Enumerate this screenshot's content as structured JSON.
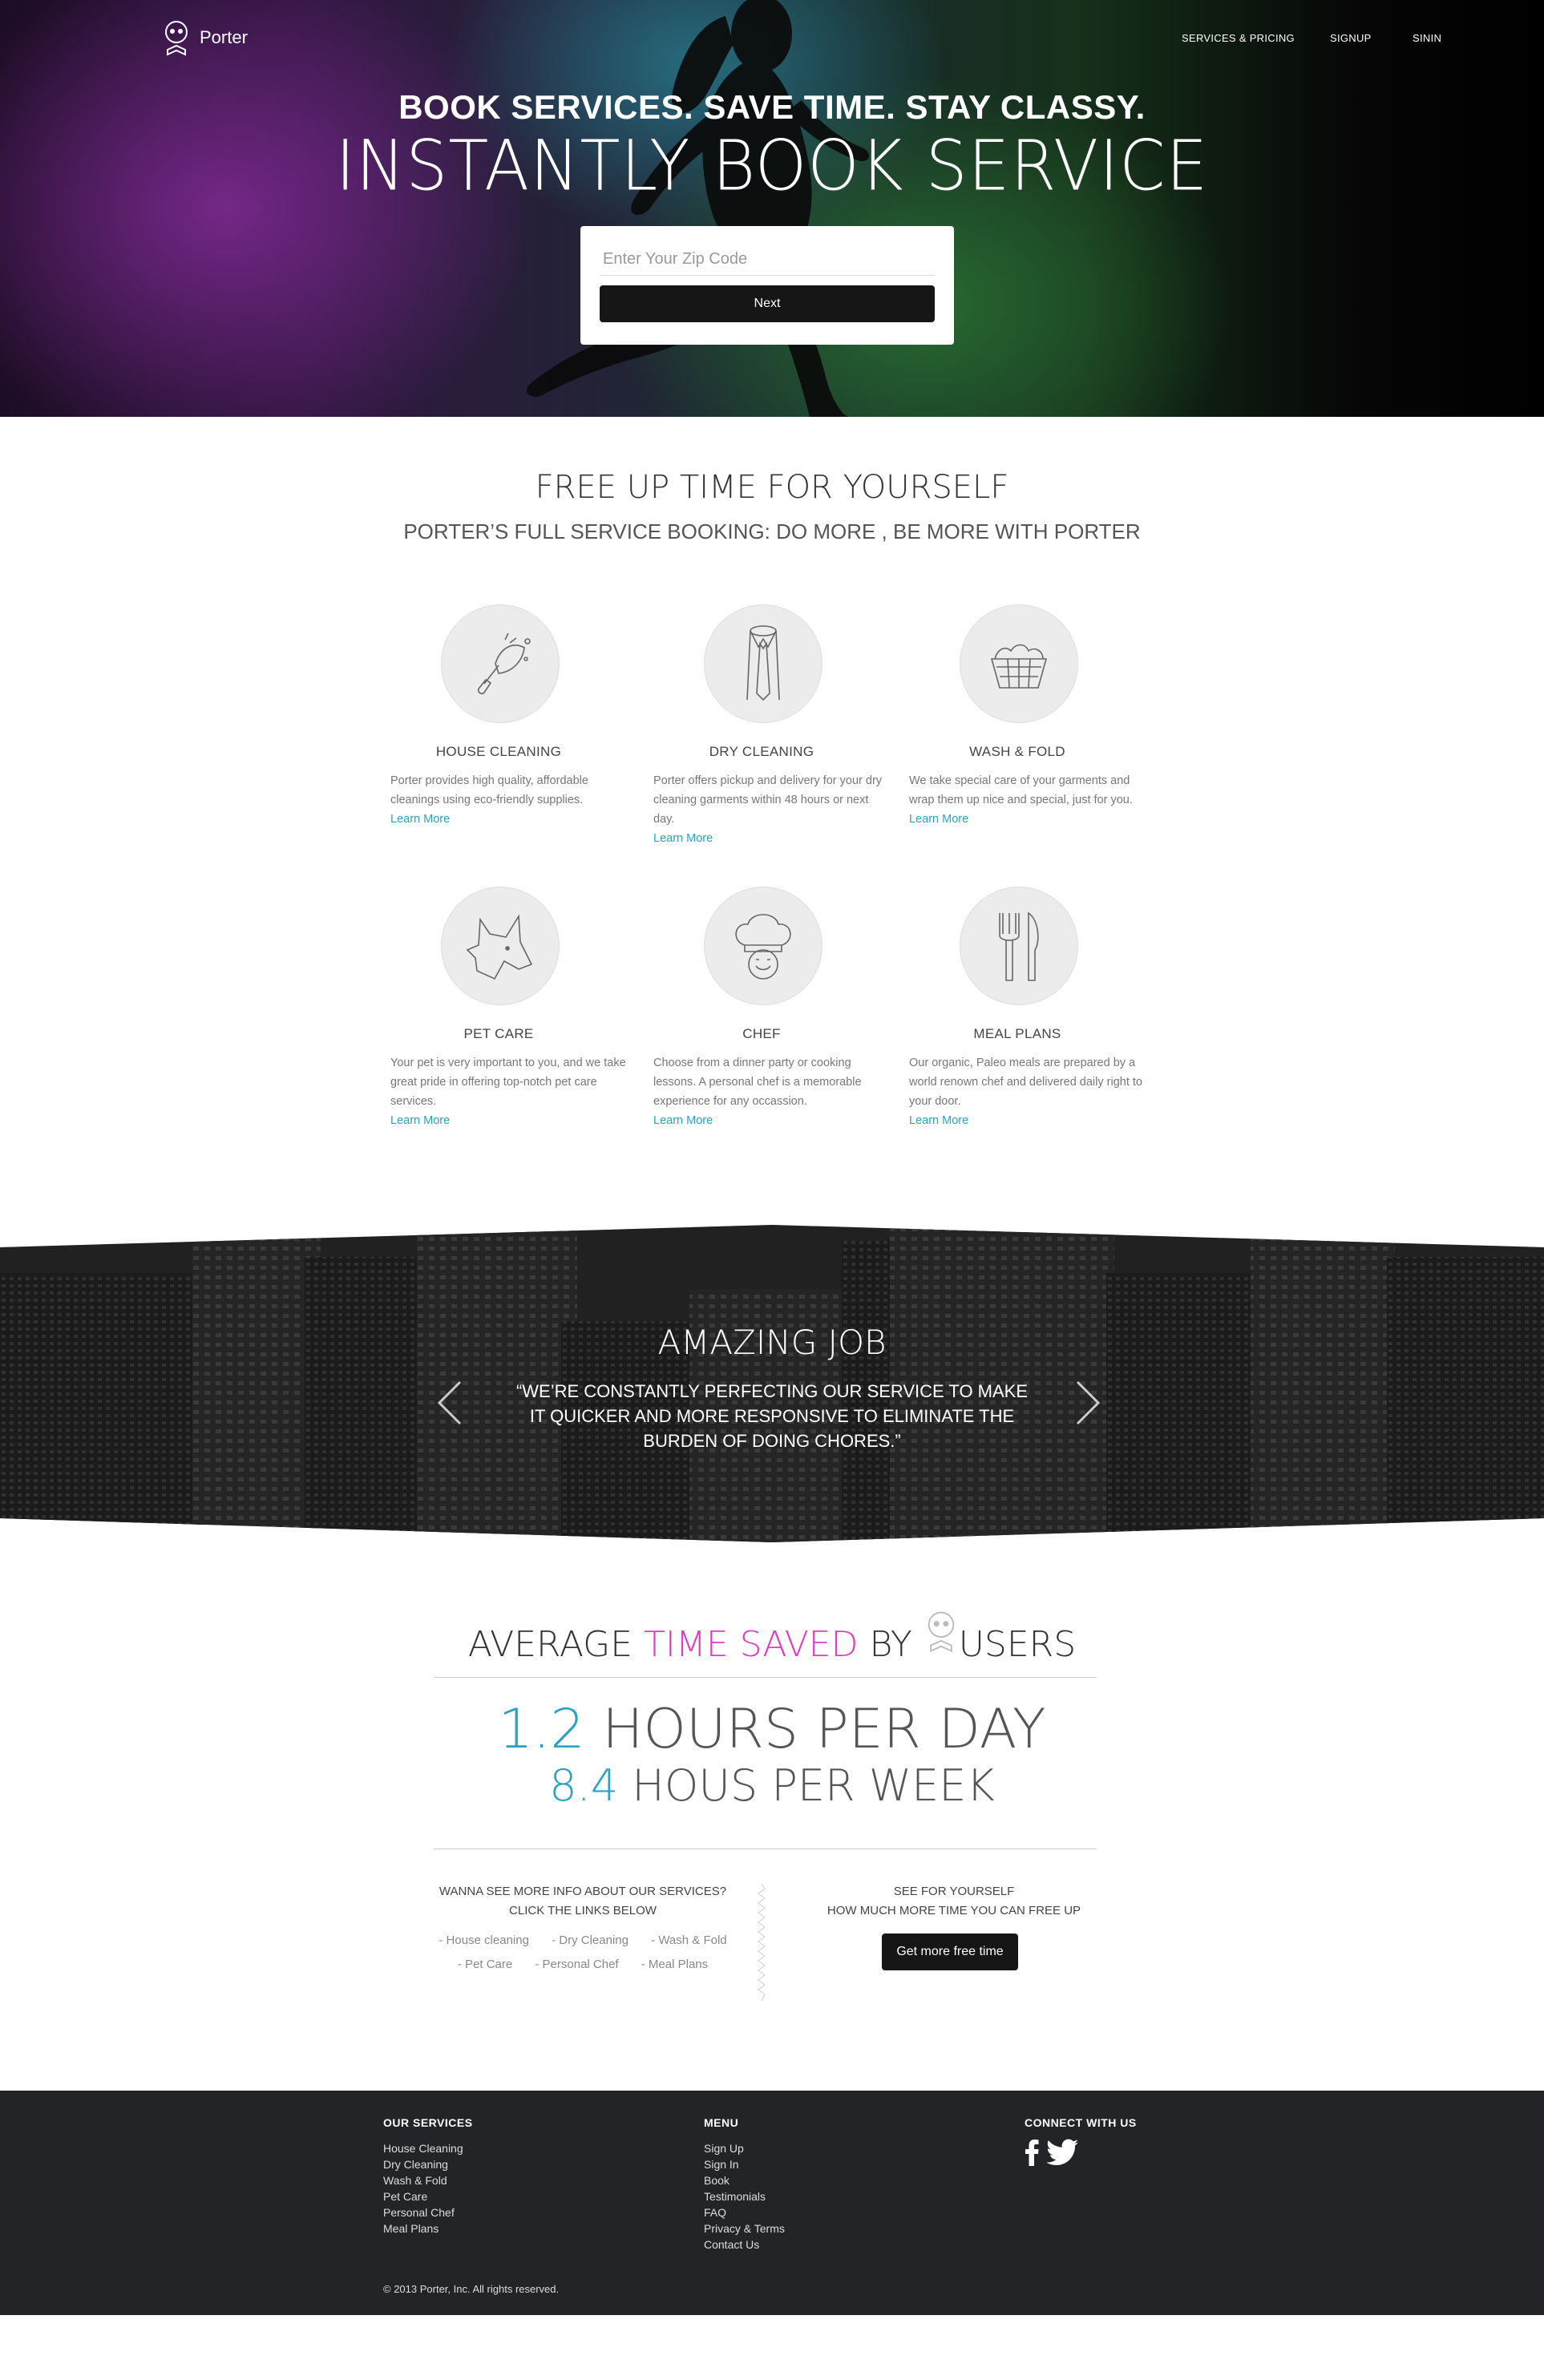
{
  "header": {
    "logo_text": "Porter",
    "nav": [
      {
        "label": "SERVICES & PRICING"
      },
      {
        "label": "SIGNUP"
      },
      {
        "label": "SININ"
      }
    ]
  },
  "hero": {
    "line1": "BOOK SERVICES. SAVE TIME. STAY CLASSY.",
    "line2": "INSTANTLY BOOK SERVICE",
    "zip_placeholder": "Enter Your Zip Code",
    "next_label": "Next"
  },
  "services_section": {
    "title": "FREE UP TIME FOR YOURSELF",
    "subtitle": "PORTER’S FULL SERVICE BOOKING: DO MORE , BE MORE WITH PORTER",
    "learn_more": "Learn More",
    "items": [
      {
        "title": "HOUSE CLEANING",
        "icon": "broom-icon",
        "desc": "Porter provides high quality, affordable cleanings using eco-friendly supplies."
      },
      {
        "title": "DRY CLEANING",
        "icon": "shirt-tie-icon",
        "desc": "Porter offers pickup and delivery for your dry cleaning garments within 48 hours or next day."
      },
      {
        "title": "WASH & FOLD",
        "icon": "laundry-basket-icon",
        "desc": "We take special care of your garments and wrap them up nice and special, just for you."
      },
      {
        "title": "PET CARE",
        "icon": "dog-head-icon",
        "desc": "Your pet is very important to you, and we take great pride in offering top-notch pet care services."
      },
      {
        "title": "CHEF",
        "icon": "chef-hat-icon",
        "desc": "Choose from a dinner party or cooking lessons. A personal chef is a memorable experience for any occassion."
      },
      {
        "title": "MEAL PLANS",
        "icon": "fork-knife-icon",
        "desc": "Our organic, Paleo meals are prepared by a world renown chef and delivered daily right to your door."
      }
    ]
  },
  "testimonial": {
    "title": "AMAZING JOB",
    "quote": "“WE’RE CONSTANTLY PERFECTING OUR SERVICE TO MAKE IT QUICKER AND MORE RESPONSIVE TO ELIMINATE THE BURDEN OF DOING CHORES.”"
  },
  "stats": {
    "title_pre": "AVERAGE ",
    "title_accent": "TIME SAVED",
    "title_mid": " BY ",
    "title_post": "USERS",
    "day_value": "1.2",
    "day_label": " HOURS PER DAY",
    "week_value": "8.4",
    "week_label": " HOUS PER WEEK",
    "accent_color": "#e33cc1",
    "number_color": "#2aa3c2"
  },
  "info": {
    "left_line1": "WANNA SEE MORE INFO ABOUT OUR SERVICES?",
    "left_line2": "CLICK THE LINKS BELOW",
    "links_row1": [
      "- House cleaning",
      "- Dry Cleaning",
      "- Wash & Fold"
    ],
    "links_row2": [
      "- Pet Care",
      "- Personal Chef",
      "- Meal Plans"
    ],
    "right_line1": "SEE FOR YOURSELF",
    "right_line2": "HOW MUCH MORE TIME YOU CAN FREE UP",
    "button_label": "Get more free time"
  },
  "footer": {
    "services_heading": "OUR SERVICES",
    "services": [
      "House Cleaning",
      "Dry Cleaning",
      "Wash & Fold",
      "Pet Care",
      "Personal Chef",
      "Meal Plans"
    ],
    "menu_heading": "MENU",
    "menu": [
      "Sign Up",
      "Sign In",
      "Book",
      "Testimonials",
      "FAQ",
      "Privacy & Terms",
      "Contact Us"
    ],
    "connect_heading": "CONNECT WITH US",
    "copyright": "© 2013 Porter, Inc. All rights reserved."
  }
}
